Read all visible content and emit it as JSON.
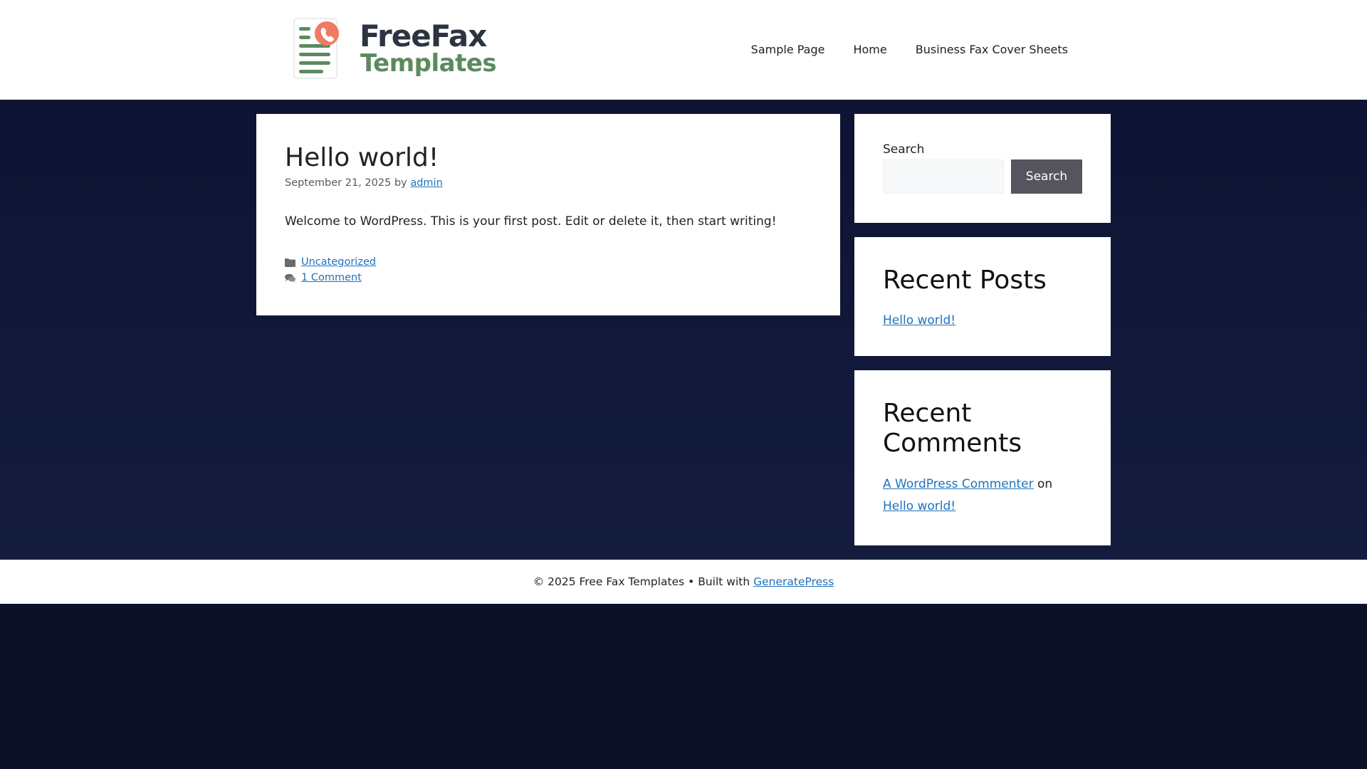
{
  "header": {
    "logo_line1": "FreeFax",
    "logo_line2": "Templates",
    "nav": [
      "Sample Page",
      "Home",
      "Business Fax Cover Sheets"
    ]
  },
  "post": {
    "title": "Hello world!",
    "date": "September 21, 2025",
    "by": "by",
    "author": "admin",
    "content": "Welcome to WordPress. This is your first post. Edit or delete it, then start writing!",
    "category": "Uncategorized",
    "comments": "1 Comment",
    "category_icon": "folder-icon",
    "comments_icon": "comments-icon"
  },
  "sidebar": {
    "search": {
      "label": "Search",
      "input_value": "",
      "button_label": "Search"
    },
    "recent_posts": {
      "title": "Recent Posts",
      "items": [
        "Hello world!"
      ]
    },
    "recent_comments": {
      "title": "Recent Comments",
      "commenter": "A WordPress Commenter",
      "on": "on",
      "post": "Hello world!"
    }
  },
  "footer": {
    "text": "© 2025 Free Fax Templates • Built with",
    "link": "GeneratePress"
  },
  "colors": {
    "background": "#0c1230",
    "logo_dark": "#2b3440",
    "logo_green": "#5b8a5f",
    "logo_accent": "#ee7b62",
    "link": "#1e72bd",
    "button": "#55555e"
  }
}
